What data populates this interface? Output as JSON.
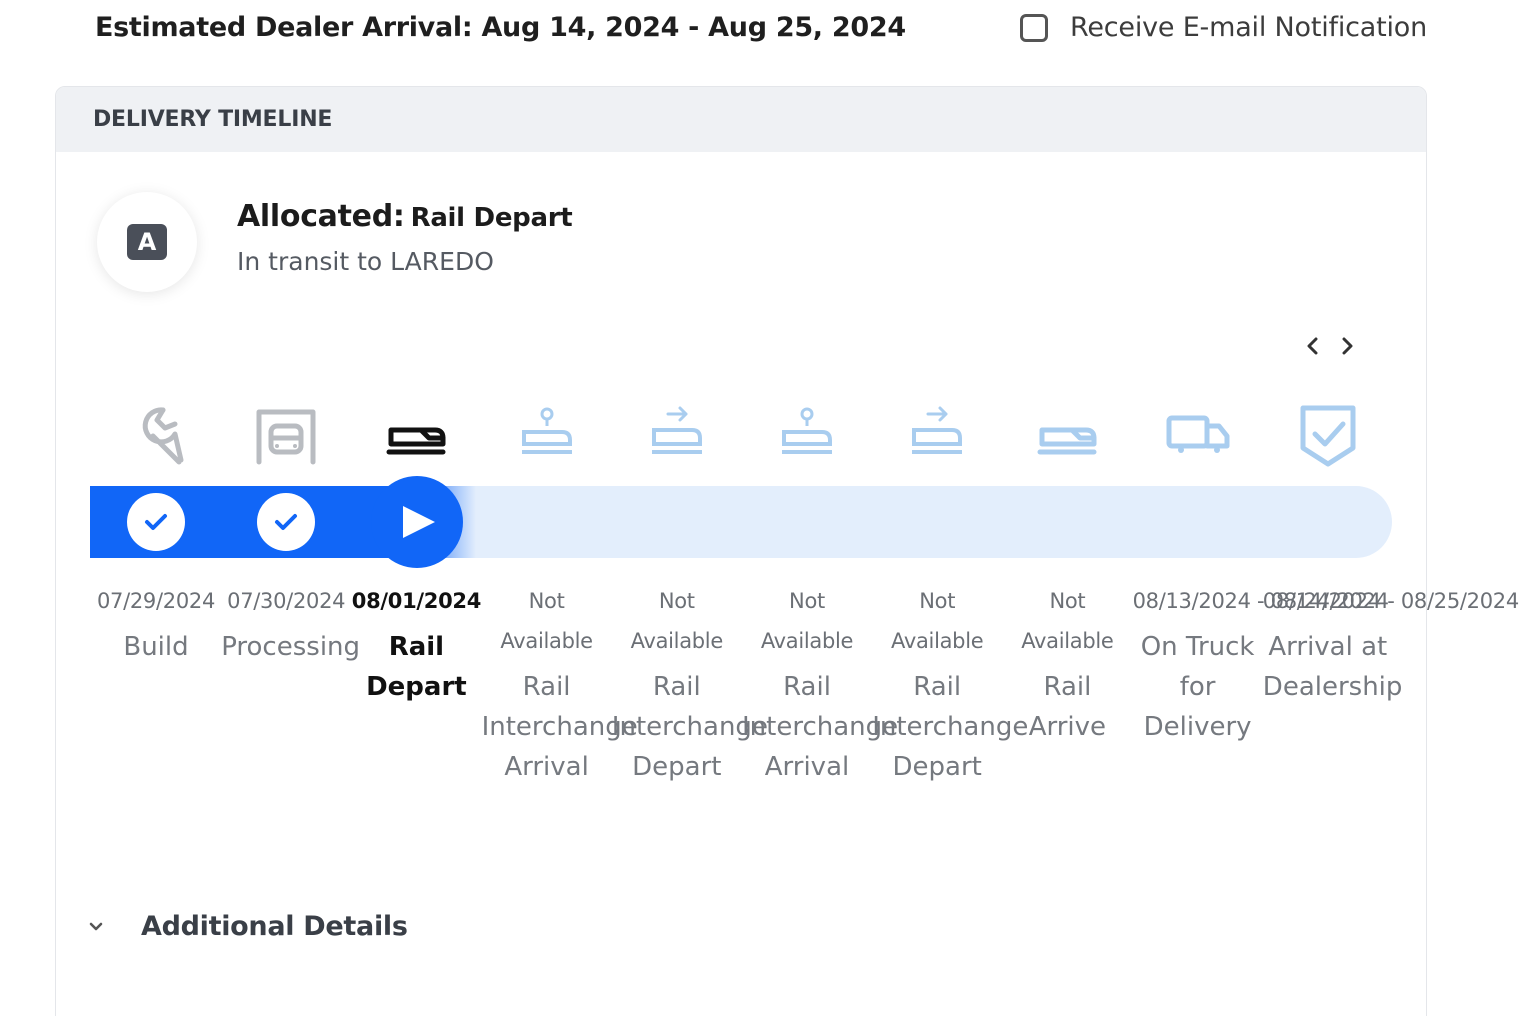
{
  "header": {
    "eta_text": "Estimated Dealer Arrival: Aug 14, 2024 - Aug 25, 2024",
    "notify_label": "Receive E-mail Notification",
    "notify_checked": false
  },
  "card": {
    "title": "DELIVERY TIMELINE",
    "avatar_letter": "A",
    "status_label": "Allocated:",
    "status_value": "Rail Depart",
    "status_sub": "In transit to LAREDO"
  },
  "colors": {
    "accent": "#1166f7",
    "track": "#e3eefc",
    "future_icon": "#a9cdef",
    "done_icon": "#b9bcc1"
  },
  "steps": [
    {
      "date": "07/29/2024",
      "name": "Build",
      "state": "done",
      "icon": "wrench-icon"
    },
    {
      "date": "07/30/2024",
      "name": "Processing",
      "state": "done",
      "icon": "garage-icon"
    },
    {
      "date": "08/01/2024",
      "name": "Rail Depart",
      "state": "current",
      "icon": "train-icon"
    },
    {
      "date": "Not Available",
      "name": "Rail Interchange Arrival",
      "state": "future",
      "icon": "train-pin-icon"
    },
    {
      "date": "Not Available",
      "name": "Rail Interchange Depart",
      "state": "future",
      "icon": "train-arrow-icon"
    },
    {
      "date": "Not Available",
      "name": "Rail Interchange Arrival",
      "state": "future",
      "icon": "train-pin-icon"
    },
    {
      "date": "Not Available",
      "name": "Rail Interchange Depart",
      "state": "future",
      "icon": "train-arrow-icon"
    },
    {
      "date": "Not Available",
      "name": "Rail Arrive",
      "state": "future",
      "icon": "train-icon"
    },
    {
      "date": "08/13/2024 - 08/24/2024",
      "name": "On Truck for Delivery",
      "state": "future",
      "icon": "truck-icon"
    },
    {
      "date": "08/14/2024 - 08/25/2024",
      "name": "Arrival at Dealership",
      "state": "future",
      "icon": "shield-check-icon"
    }
  ],
  "details": {
    "label": "Additional Details"
  }
}
